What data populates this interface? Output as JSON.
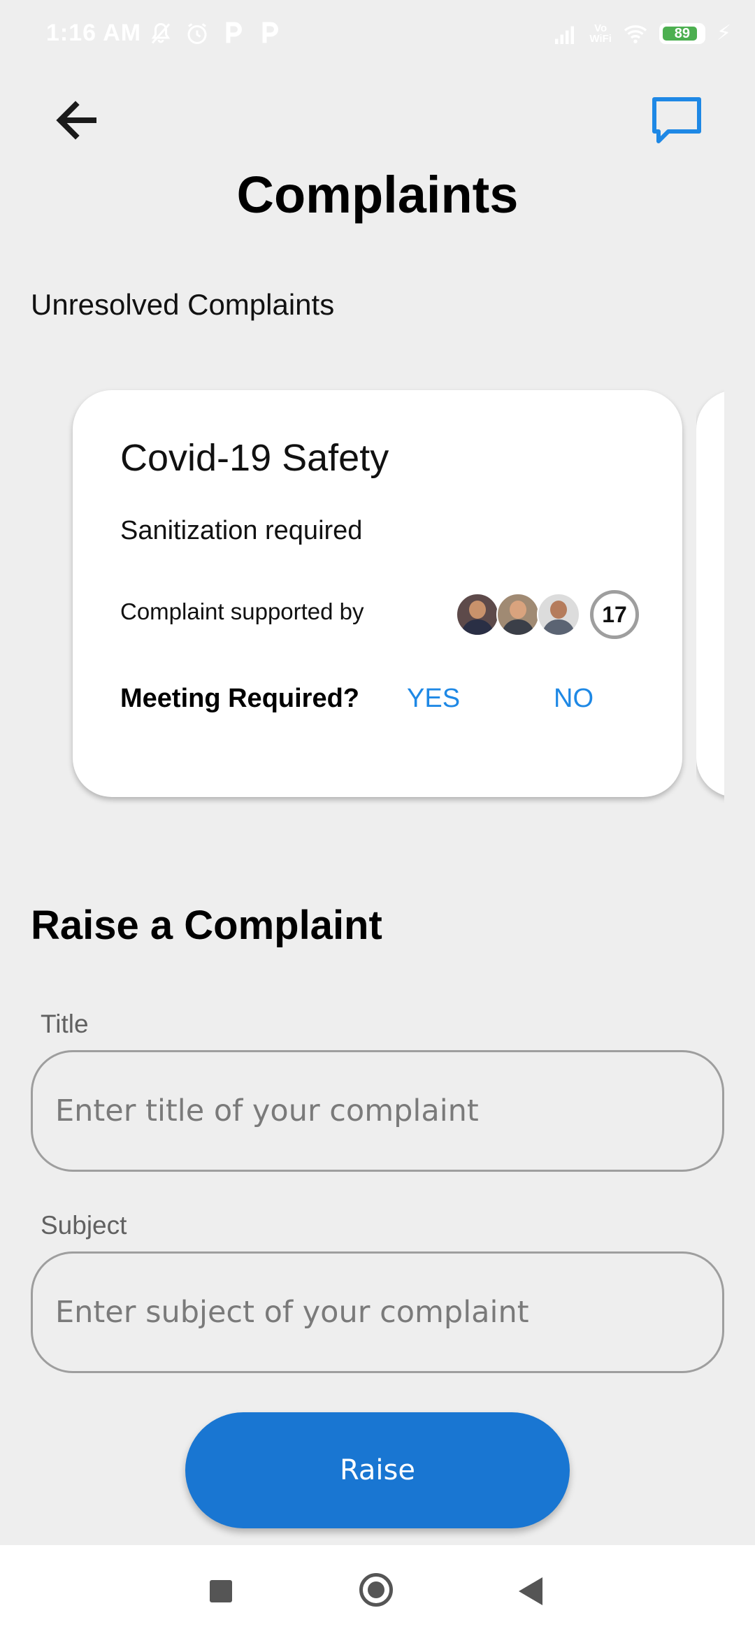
{
  "status_bar": {
    "time": "1:16 AM",
    "left_icons": [
      "mute-icon",
      "alarm-icon",
      "parking-app-icon",
      "parking-app-icon"
    ],
    "vowifi_top": "Vo",
    "vowifi_bottom": "WiFi",
    "battery_level": "89",
    "battery_fraction": 0.89,
    "battery_color": "#4caf50"
  },
  "header": {
    "back_icon": "arrow-left-icon",
    "chat_icon": "chat-bubble-icon",
    "title": "Complaints",
    "accent_color": "#1e88e5"
  },
  "unresolved": {
    "section_label": "Unresolved Complaints",
    "cards": [
      {
        "title": "Covid-19 Safety",
        "subject": "Sanitization required",
        "supported_label": "Complaint supported by",
        "supporter_avatars": [
          "avatar-1",
          "avatar-2",
          "avatar-3"
        ],
        "supporter_count": "17",
        "meeting_label": "Meeting Required?",
        "yes_label": "YES",
        "no_label": "NO"
      }
    ]
  },
  "form": {
    "heading": "Raise a Complaint",
    "title_label": "Title",
    "title_placeholder": "Enter title of your complaint",
    "title_value": "",
    "subject_label": "Subject",
    "subject_placeholder": "Enter subject of your complaint",
    "subject_value": "",
    "submit_label": "Raise",
    "button_color": "#1976d2"
  },
  "nav_bar": {
    "icons": [
      "recent-apps-icon",
      "home-icon",
      "back-triangle-icon"
    ]
  }
}
